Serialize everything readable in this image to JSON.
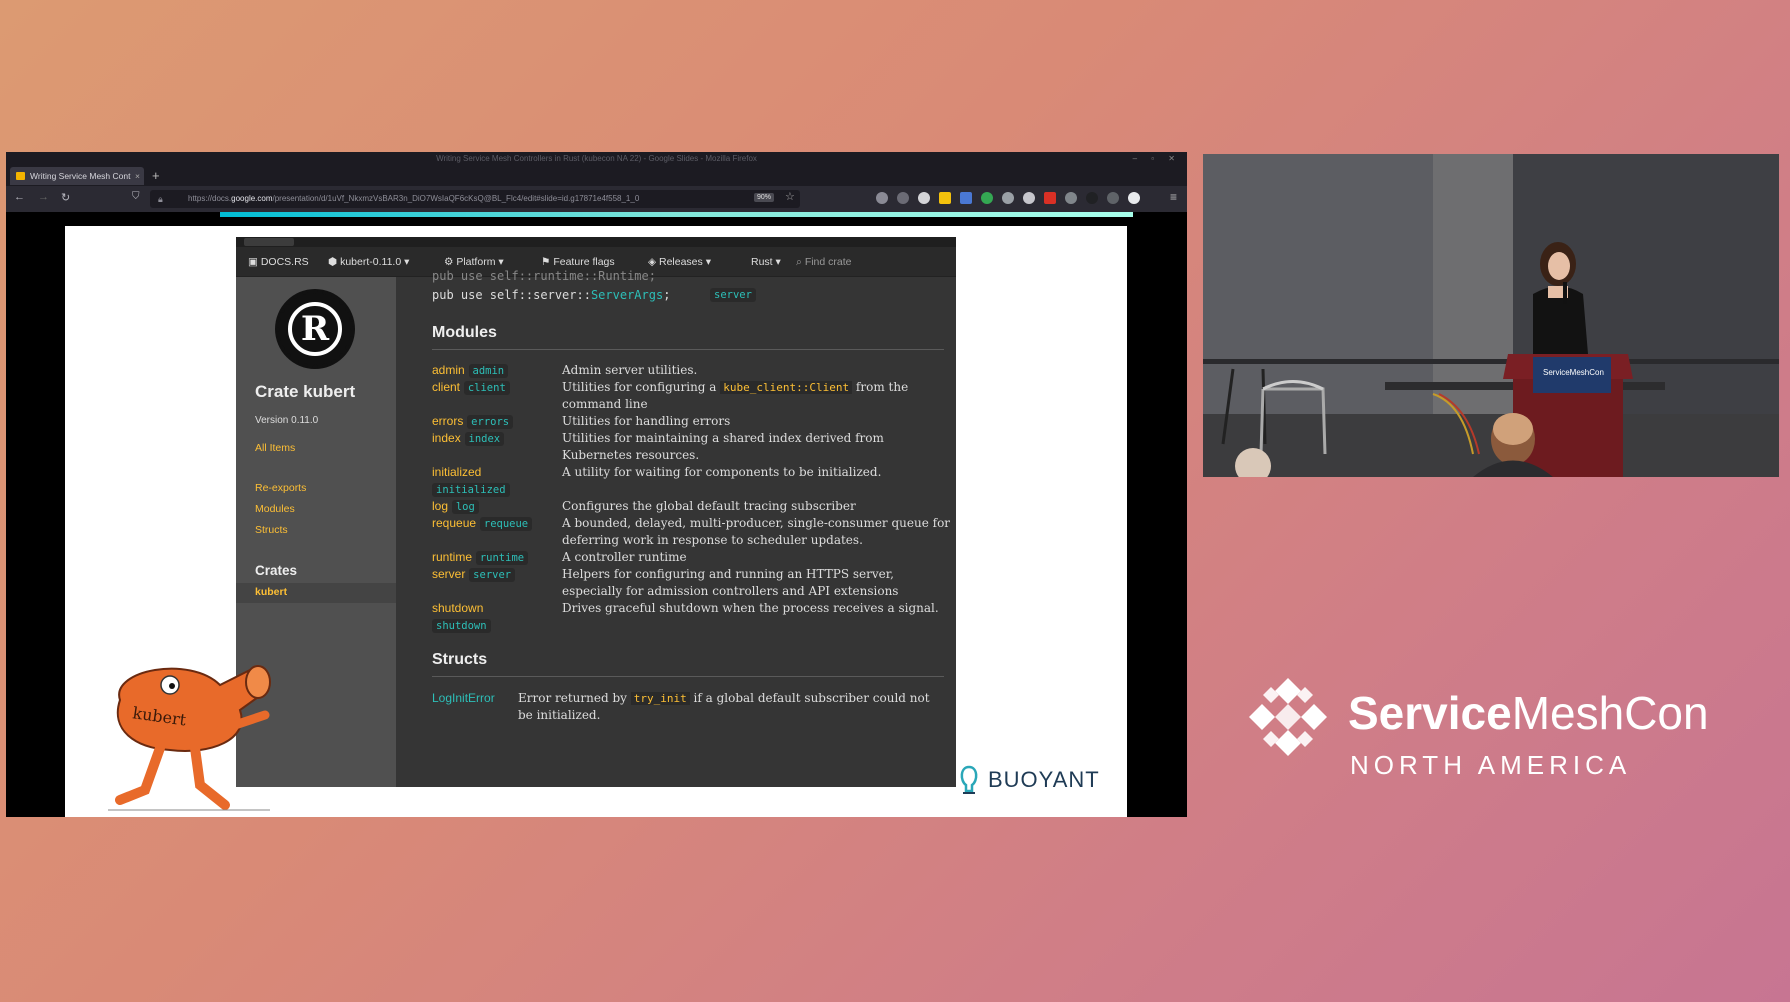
{
  "browser": {
    "window_title": "Writing Service Mesh Controllers in Rust (kubecon NA 22) - Google Slides - Mozilla Firefox",
    "tab_title": "Writing Service Mesh Cont",
    "url_prefix": "https://docs.",
    "url_host": "google.com",
    "url_rest": "/presentation/d/1uVf_NkxmzVsBAR3n_DiO7WsIaQF6cKsQ@BL_Flc4/edit#slide=id.g17871e4f558_1_0",
    "zoom": "90%"
  },
  "docs": {
    "brand": "DOCS.RS",
    "crate_version": "kubert-0.11.0",
    "menu": [
      "Platform",
      "Feature flags",
      "Releases",
      "Rust"
    ],
    "search_placeholder": "Find crate",
    "sidebar": {
      "title": "Crate kubert",
      "version": "Version 0.11.0",
      "all_items": "All Items",
      "links": [
        "Re-exports",
        "Modules",
        "Structs"
      ],
      "crates_heading": "Crates",
      "active_crate": "kubert"
    },
    "reexport": {
      "prefix": "pub use self::server::",
      "name": "ServerArgs",
      "suffix": ";",
      "feature": "server"
    },
    "modules_heading": "Modules",
    "modules": [
      {
        "name": "admin",
        "chip": "admin",
        "desc": "Admin server utilities."
      },
      {
        "name": "client",
        "chip": "client",
        "desc_a": "Utilities for configuring a ",
        "code": "kube_client::Client",
        "desc_b": " from the command line"
      },
      {
        "name": "errors",
        "chip": "errors",
        "desc": "Utilities for handling errors"
      },
      {
        "name": "index",
        "chip": "index",
        "desc": "Utilities for maintaining a shared index derived from Kubernetes resources."
      },
      {
        "name": "initialized",
        "chip": "initialized",
        "desc": "A utility for waiting for components to be initialized."
      },
      {
        "name": "log",
        "chip": "log",
        "desc": "Configures the global default tracing subscriber"
      },
      {
        "name": "requeue",
        "chip": "requeue",
        "desc": "A bounded, delayed, multi-producer, single-consumer queue for deferring work in response to scheduler updates."
      },
      {
        "name": "runtime",
        "chip": "runtime",
        "desc": "A controller runtime"
      },
      {
        "name": "server",
        "chip": "server",
        "desc": "Helpers for configuring and running an HTTPS server, especially for admission controllers and API extensions"
      },
      {
        "name": "shutdown",
        "chip": "shutdown",
        "desc": "Drives graceful shutdown when the process receives a signal."
      }
    ],
    "structs_heading": "Structs",
    "structs": [
      {
        "name": "LogInitError",
        "desc_a": "Error returned by ",
        "code": "try_init",
        "desc_b": " if a global default subscriber could not be initialized."
      }
    ]
  },
  "slide": {
    "mascot_label": "kubert",
    "sponsor": "BUOYANT"
  },
  "event": {
    "name_bold": "Service",
    "name_rest": "MeshCon",
    "region": "NORTH AMERICA",
    "podium_label": "ServiceMeshCon"
  },
  "colors": {
    "docs_link": "#fdbf35",
    "docs_teal": "#2dbfb8",
    "docs_bg": "#353535",
    "sidebar_bg": "#505050"
  }
}
